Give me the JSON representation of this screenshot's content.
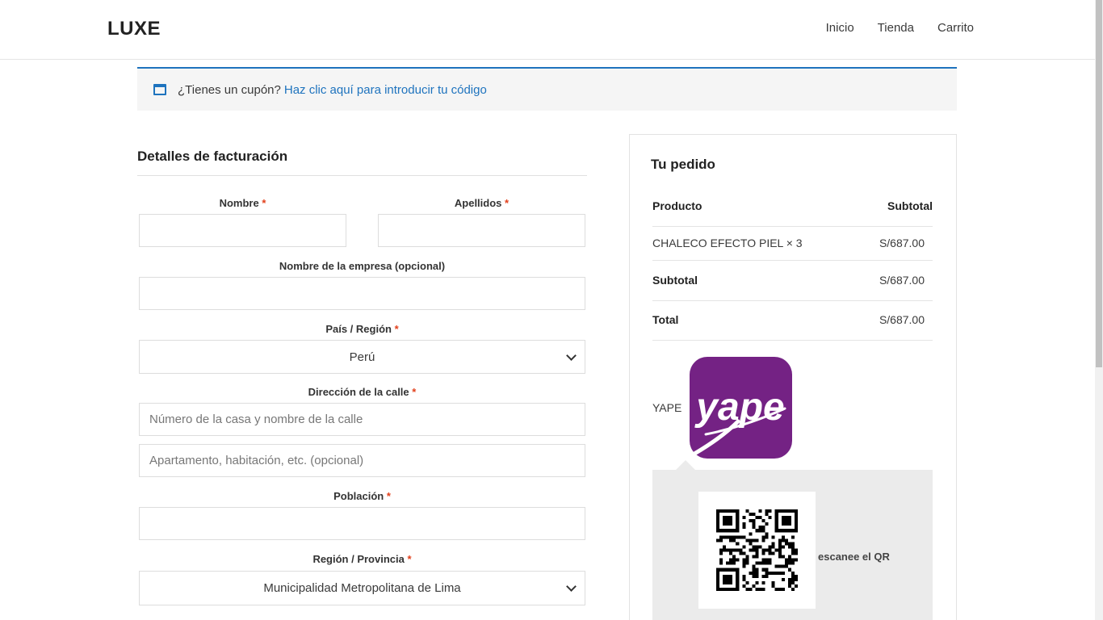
{
  "header": {
    "logo": "LUXE",
    "nav": [
      "Inicio",
      "Tienda",
      "Carrito"
    ]
  },
  "coupon": {
    "text": "¿Tienes un cupón?",
    "link": "Haz clic aquí para introducir tu código"
  },
  "billing": {
    "title": "Detalles de facturación",
    "required_mark": "*",
    "nombre_label": "Nombre",
    "apellidos_label": "Apellidos",
    "empresa_label": "Nombre de la empresa (opcional)",
    "pais_label": "País / Región",
    "pais_value": "Perú",
    "direccion_label": "Dirección de la calle",
    "direccion_placeholder": "Número de la casa y nombre de la calle",
    "apartamento_placeholder": "Apartamento, habitación, etc. (opcional)",
    "poblacion_label": "Población",
    "region_label": "Región / Provincia",
    "region_value": "Municipalidad Metropolitana de Lima"
  },
  "order": {
    "title": "Tu pedido",
    "col_product": "Producto",
    "col_subtotal": "Subtotal",
    "item_name": "CHALECO EFECTO PIEL",
    "item_qty": "× 3",
    "item_price": "S/687.00",
    "subtotal_label": "Subtotal",
    "subtotal_value": "S/687.00",
    "total_label": "Total",
    "total_value": "S/687.00",
    "payment_method": "YAPE",
    "payment_logo_text": "yape",
    "qr_text": "escanee el QR"
  },
  "colors": {
    "accent": "#1e73be",
    "required": "#e2401c",
    "yape_purple": "#742284"
  }
}
